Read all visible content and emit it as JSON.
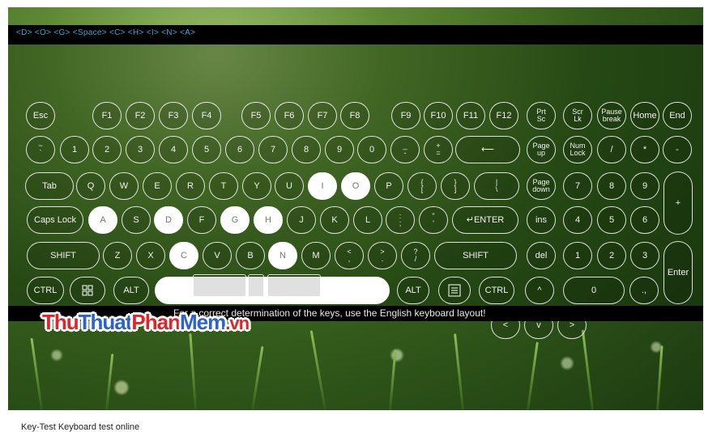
{
  "top_bar": {
    "typed_text": "<D> <O> <G> <Space> <C> <H> <I> <N> <A>"
  },
  "hint": "For a correct determination of the keys, use the English keyboard layout!",
  "brand": {
    "part1": "Thu",
    "part2": "Thuat",
    "part3": "Phan",
    "part4": "Mem",
    "part5": ".vn"
  },
  "status_text": "Key-Test Keyboard test online",
  "colors": {
    "key_border": "#ffffff",
    "key_lit": "#ffffff",
    "word_text": "#3aa7d8",
    "brand_red": "#e0242a",
    "brand_blue": "#2c63c8"
  },
  "keys": [
    {
      "id": "esc",
      "label": "Esc",
      "lit": false
    },
    {
      "id": "f1",
      "label": "F1",
      "lit": false
    },
    {
      "id": "f2",
      "label": "F2",
      "lit": false
    },
    {
      "id": "f3",
      "label": "F3",
      "lit": false
    },
    {
      "id": "f4",
      "label": "F4",
      "lit": false
    },
    {
      "id": "f5",
      "label": "F5",
      "lit": false
    },
    {
      "id": "f6",
      "label": "F6",
      "lit": false
    },
    {
      "id": "f7",
      "label": "F7",
      "lit": false
    },
    {
      "id": "f8",
      "label": "F8",
      "lit": false
    },
    {
      "id": "f9",
      "label": "F9",
      "lit": false
    },
    {
      "id": "f10",
      "label": "F10",
      "lit": false
    },
    {
      "id": "f11",
      "label": "F11",
      "lit": false
    },
    {
      "id": "f12",
      "label": "F12",
      "lit": false
    },
    {
      "id": "prtsc",
      "label": "Prt\nSc",
      "lit": false
    },
    {
      "id": "scrlk",
      "label": "Scr\nLk",
      "lit": false
    },
    {
      "id": "pause",
      "label": "Pause\nbreak",
      "lit": false
    },
    {
      "id": "home",
      "label": "Home",
      "lit": false
    },
    {
      "id": "end",
      "label": "End",
      "lit": false
    },
    {
      "id": "tilde",
      "label": "~\n`",
      "lit": false
    },
    {
      "id": "d1",
      "label": "1",
      "lit": false
    },
    {
      "id": "d2",
      "label": "2",
      "lit": false
    },
    {
      "id": "d3",
      "label": "3",
      "lit": false
    },
    {
      "id": "d4",
      "label": "4",
      "lit": false
    },
    {
      "id": "d5",
      "label": "5",
      "lit": false
    },
    {
      "id": "d6",
      "label": "6",
      "lit": false
    },
    {
      "id": "d7",
      "label": "7",
      "lit": false
    },
    {
      "id": "d8",
      "label": "8",
      "lit": false
    },
    {
      "id": "d9",
      "label": "9",
      "lit": false
    },
    {
      "id": "d0",
      "label": "0",
      "lit": false
    },
    {
      "id": "minus",
      "label": "_\n-",
      "lit": false
    },
    {
      "id": "plus",
      "label": "+\n=",
      "lit": false
    },
    {
      "id": "backspace",
      "label": "⟵",
      "lit": false
    },
    {
      "id": "pgup",
      "label": "Page\nup",
      "lit": false
    },
    {
      "id": "numlock",
      "label": "Num\nLock",
      "lit": false
    },
    {
      "id": "npdiv",
      "label": "/",
      "lit": false
    },
    {
      "id": "npmul",
      "label": "*",
      "lit": false
    },
    {
      "id": "npsub",
      "label": "-",
      "lit": false
    },
    {
      "id": "tab",
      "label": "Tab",
      "lit": false
    },
    {
      "id": "q",
      "label": "Q",
      "lit": false
    },
    {
      "id": "w",
      "label": "W",
      "lit": false
    },
    {
      "id": "e",
      "label": "E",
      "lit": false
    },
    {
      "id": "r",
      "label": "R",
      "lit": false
    },
    {
      "id": "t",
      "label": "T",
      "lit": false
    },
    {
      "id": "y",
      "label": "Y",
      "lit": false
    },
    {
      "id": "u",
      "label": "U",
      "lit": false
    },
    {
      "id": "i",
      "label": "I",
      "lit": true
    },
    {
      "id": "o",
      "label": "O",
      "lit": true
    },
    {
      "id": "p",
      "label": "P",
      "lit": false
    },
    {
      "id": "lbrace",
      "label": "{\n[",
      "lit": false
    },
    {
      "id": "rbrace",
      "label": "}\n]",
      "lit": false
    },
    {
      "id": "pipe",
      "label": "|\n\\",
      "lit": false
    },
    {
      "id": "pgdn",
      "label": "Page\ndown",
      "lit": false
    },
    {
      "id": "np7",
      "label": "7",
      "lit": false
    },
    {
      "id": "np8",
      "label": "8",
      "lit": false
    },
    {
      "id": "np9",
      "label": "9",
      "lit": false
    },
    {
      "id": "npadd",
      "label": "+",
      "lit": false
    },
    {
      "id": "caps",
      "label": "Caps Lock",
      "lit": false
    },
    {
      "id": "a",
      "label": "A",
      "lit": true
    },
    {
      "id": "s",
      "label": "S",
      "lit": false
    },
    {
      "id": "d",
      "label": "D",
      "lit": true
    },
    {
      "id": "f",
      "label": "F",
      "lit": false
    },
    {
      "id": "g",
      "label": "G",
      "lit": true
    },
    {
      "id": "h",
      "label": "H",
      "lit": true
    },
    {
      "id": "j",
      "label": "J",
      "lit": false
    },
    {
      "id": "k",
      "label": "K",
      "lit": false
    },
    {
      "id": "l",
      "label": "L",
      "lit": false
    },
    {
      "id": "semi",
      "label": ":\n;",
      "lit": false
    },
    {
      "id": "quote",
      "label": "\"\n'",
      "lit": false
    },
    {
      "id": "enter",
      "label": "↵ENTER",
      "lit": false
    },
    {
      "id": "ins",
      "label": "ins",
      "lit": false
    },
    {
      "id": "np4",
      "label": "4",
      "lit": false
    },
    {
      "id": "np5",
      "label": "5",
      "lit": false
    },
    {
      "id": "np6",
      "label": "6",
      "lit": false
    },
    {
      "id": "lshift",
      "label": "SHIFT",
      "lit": false
    },
    {
      "id": "z",
      "label": "Z",
      "lit": false
    },
    {
      "id": "x",
      "label": "X",
      "lit": false
    },
    {
      "id": "c",
      "label": "C",
      "lit": true
    },
    {
      "id": "v",
      "label": "V",
      "lit": false
    },
    {
      "id": "b",
      "label": "B",
      "lit": false
    },
    {
      "id": "n",
      "label": "N",
      "lit": true
    },
    {
      "id": "m",
      "label": "M",
      "lit": false
    },
    {
      "id": "lt",
      "label": "<\n,",
      "lit": false
    },
    {
      "id": "gt",
      "label": ">\n.",
      "lit": false
    },
    {
      "id": "qm",
      "label": "?\n/",
      "lit": false
    },
    {
      "id": "rshift",
      "label": "SHIFT",
      "lit": false
    },
    {
      "id": "del",
      "label": "del",
      "lit": false
    },
    {
      "id": "np1",
      "label": "1",
      "lit": false
    },
    {
      "id": "np2",
      "label": "2",
      "lit": false
    },
    {
      "id": "np3",
      "label": "3",
      "lit": false
    },
    {
      "id": "npenter",
      "label": "Enter",
      "lit": false
    },
    {
      "id": "lctrl",
      "label": "CTRL",
      "lit": false
    },
    {
      "id": "win",
      "label": "",
      "lit": false
    },
    {
      "id": "lalt",
      "label": "ALT",
      "lit": false
    },
    {
      "id": "space",
      "label": "",
      "lit": true
    },
    {
      "id": "ralt",
      "label": "ALT",
      "lit": false
    },
    {
      "id": "menu",
      "label": "",
      "lit": false
    },
    {
      "id": "rctrl",
      "label": "CTRL",
      "lit": false
    },
    {
      "id": "up",
      "label": "^",
      "lit": false
    },
    {
      "id": "np0",
      "label": "0",
      "lit": false
    },
    {
      "id": "npdot",
      "label": ".,",
      "lit": false
    },
    {
      "id": "left",
      "label": "<",
      "lit": false
    },
    {
      "id": "down",
      "label": "v",
      "lit": false
    },
    {
      "id": "right",
      "label": ">",
      "lit": false
    }
  ]
}
